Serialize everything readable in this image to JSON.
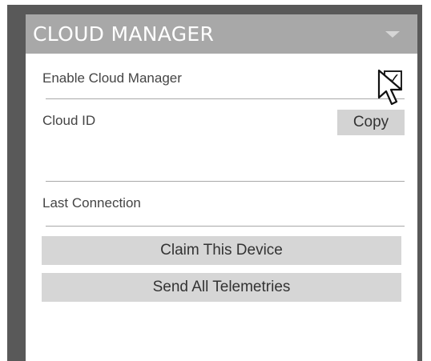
{
  "header": {
    "title": "CLOUD MANAGER"
  },
  "settings": {
    "enable_label": "Enable Cloud Manager",
    "enabled": true,
    "checkmark_glyph": "✓",
    "cloud_id_label": "Cloud ID",
    "cloud_id_value": "",
    "copy_label": "Copy",
    "last_connection_label": "Last Connection",
    "last_connection_value": ""
  },
  "actions": {
    "claim_label": "Claim This Device",
    "telemetry_label": "Send All Telemetries"
  },
  "icons": {
    "collapse": "chevron-down-icon",
    "pointer": "mouse-cursor-icon"
  },
  "colors": {
    "header_bg": "#a8a8a8",
    "frame_bg": "#595959",
    "button_bg": "#d6d6d6"
  }
}
